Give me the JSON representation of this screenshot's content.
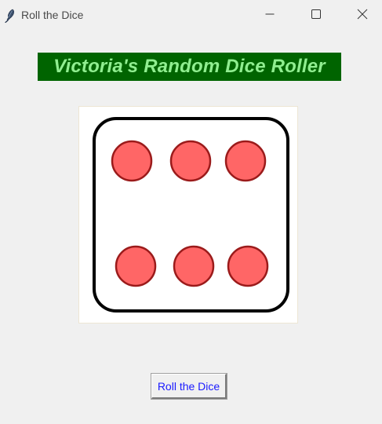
{
  "window": {
    "title": "Roll the Dice",
    "app_icon": "feather-icon"
  },
  "controls": {
    "minimize_icon": "minimize-icon",
    "maximize_icon": "maximize-icon",
    "close_icon": "close-icon"
  },
  "banner": {
    "text": "Victoria's Random Dice Roller",
    "background": "#006400",
    "text_color": "#90ee90"
  },
  "die": {
    "face_value": 6,
    "pip_fill": "#ff6666",
    "pip_stroke": "#9b1b1b",
    "border_color": "#000000"
  },
  "roll_button": {
    "label": "Roll the Dice",
    "text_color": "#1a1aff"
  }
}
